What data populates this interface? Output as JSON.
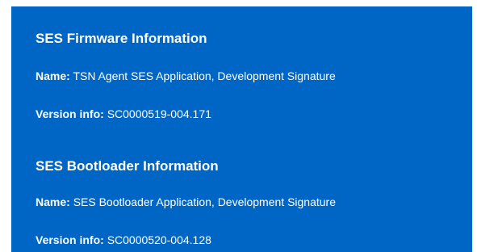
{
  "firmware": {
    "heading": "SES Firmware Information",
    "name_label": "Name:",
    "name_value": "TSN Agent SES Application, Development Signature",
    "version_label": "Version info:",
    "version_value": "SC0000519-004.171"
  },
  "bootloader": {
    "heading": "SES Bootloader Information",
    "name_label": "Name:",
    "name_value": "SES Bootloader Application, Development Signature",
    "version_label": "Version info:",
    "version_value": "SC0000520-004.128"
  },
  "colors": {
    "panel_background": "#0066c5",
    "text": "#ffffff"
  }
}
